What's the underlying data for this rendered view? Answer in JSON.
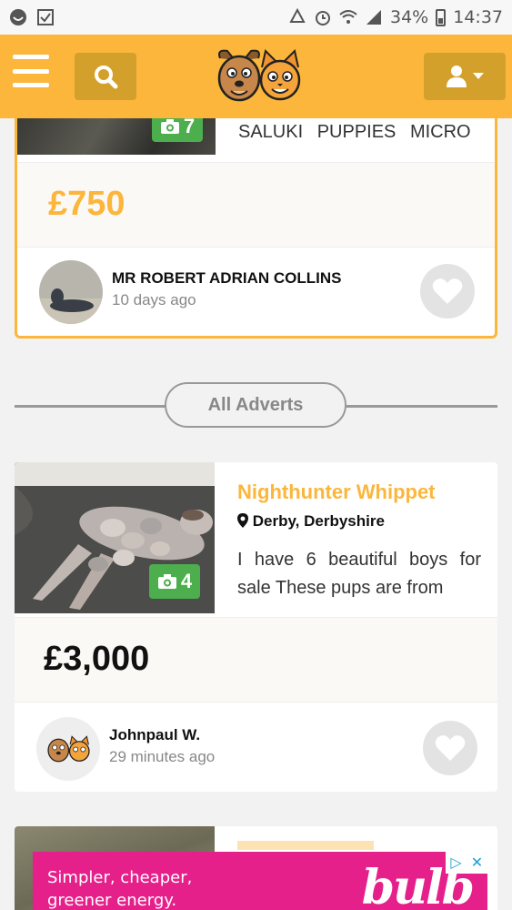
{
  "statusbar": {
    "battery": "34%",
    "time": "14:37"
  },
  "colors": {
    "brand": "#fbb63b",
    "brand_dark": "#d4a02c",
    "photo_badge": "#4cae4c",
    "banner": "#e5208a"
  },
  "header": {
    "menu_icon": "hamburger-icon",
    "search_icon": "search-icon",
    "logo": "dog-and-cat-logo",
    "account_icon": "user-icon"
  },
  "featured_ad": {
    "title": "SALUKI PUPPIES MICRO",
    "photo_count": "7",
    "price": "£750",
    "seller": {
      "name": "MR ROBERT ADRIAN COLLINS",
      "time": "10 days ago"
    }
  },
  "divider": {
    "label": "All Adverts"
  },
  "adverts": [
    {
      "title": "Nighthunter Whippet",
      "location": "Derby, Derbyshire",
      "description": "I have 6 beautiful boys for sale These pups are from",
      "photo_count": "4",
      "price": "£3,000",
      "seller": {
        "name": "Johnpaul W.",
        "time": "29 minutes ago"
      }
    }
  ],
  "banner": {
    "line1": "Simpler, cheaper,",
    "line2": "greener energy.",
    "brand": "bulb"
  }
}
